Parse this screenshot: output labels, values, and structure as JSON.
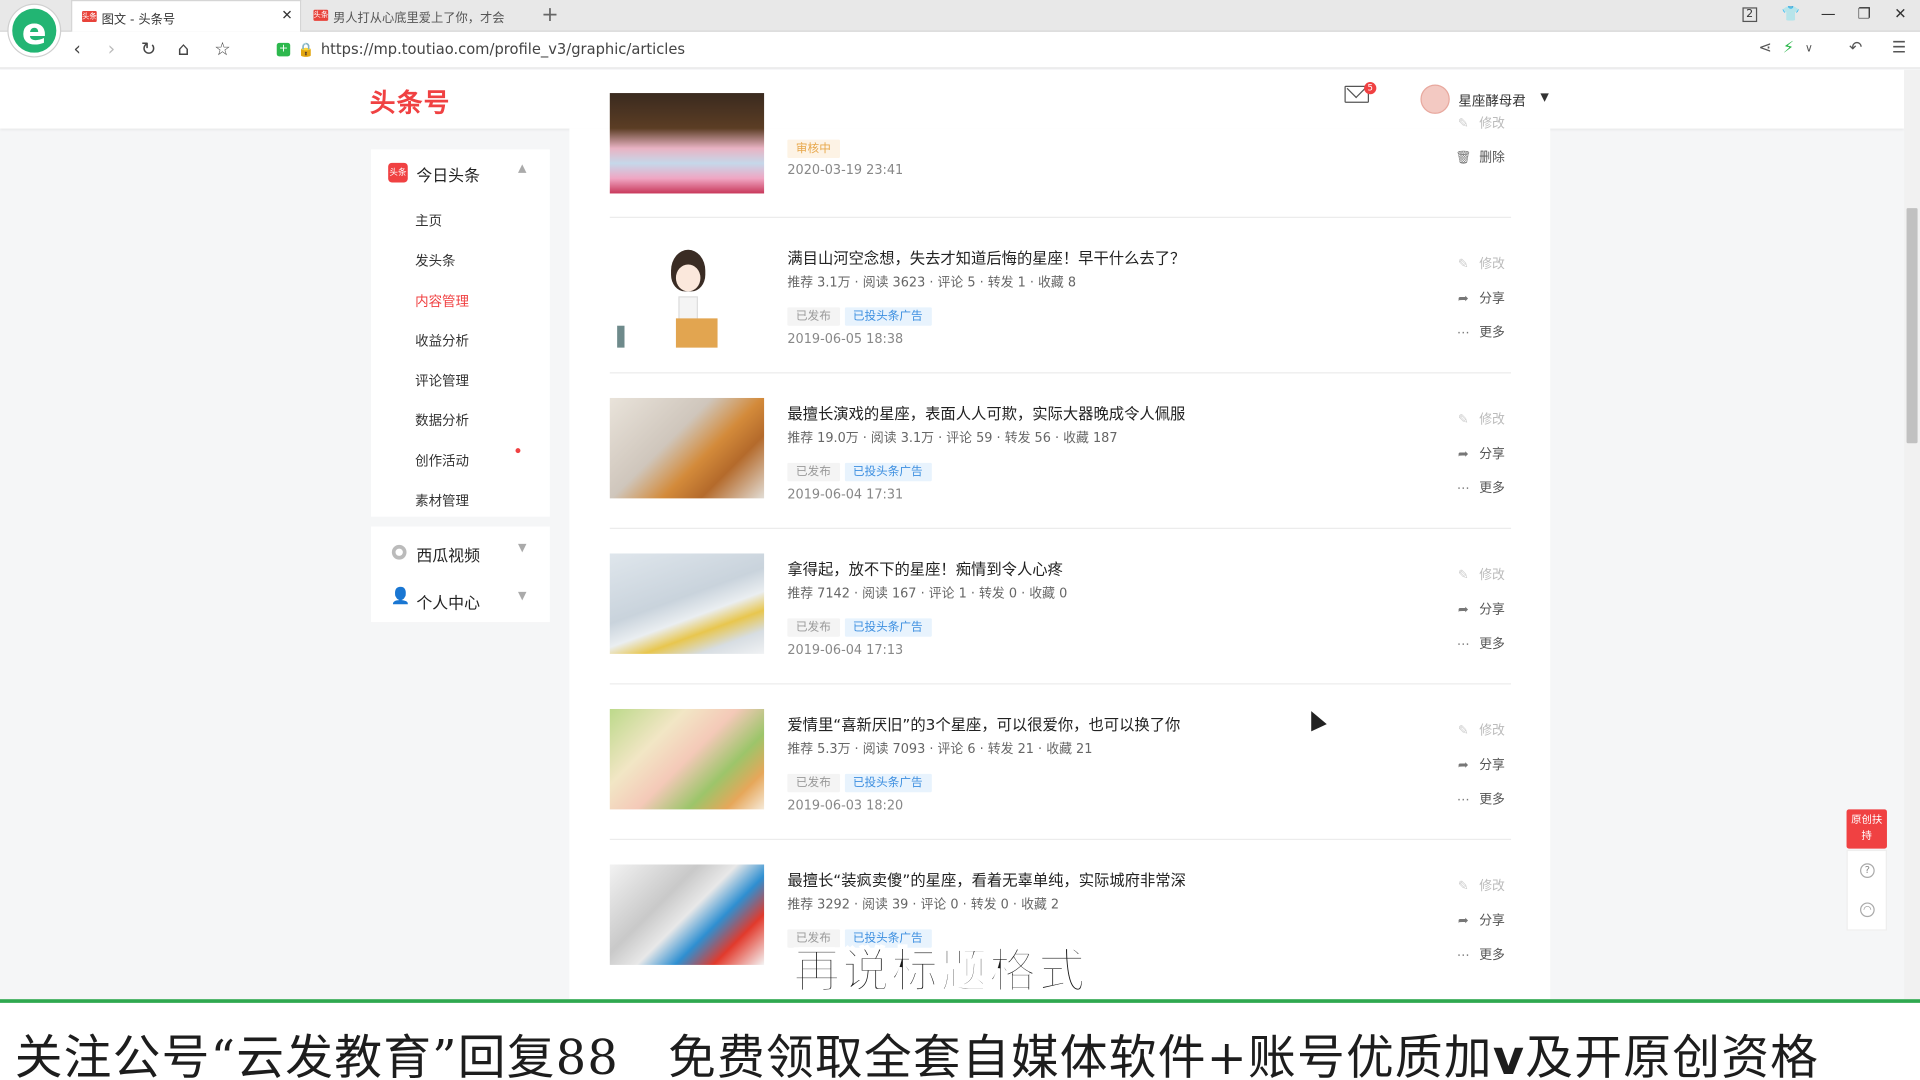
{
  "browser": {
    "tabs": [
      {
        "label": "图文 - 头条号",
        "favicon": "头条"
      },
      {
        "label": "男人打从心底里爱上了你，才会",
        "favicon": "头条"
      }
    ],
    "new_tab": "+",
    "url": "https://mp.toutiao.com/profile_v3/graphic/articles",
    "tab_counter": "2"
  },
  "header": {
    "brand": "头条号",
    "mail_badge": "5",
    "username": "星座酵母君"
  },
  "sidebar": {
    "section1": {
      "label": "今日头条",
      "icon_text": "头条"
    },
    "items": [
      "主页",
      "发头条",
      "内容管理",
      "收益分析",
      "评论管理",
      "数据分析",
      "创作活动",
      "素材管理"
    ],
    "active_index": 2,
    "section2": {
      "label": "西瓜视频"
    },
    "section3": {
      "label": "个人中心"
    }
  },
  "articles": [
    {
      "title": "",
      "stats": "",
      "tags": [
        "审核中"
      ],
      "date": "2020-03-19 23:41",
      "actions": {
        "edit": "修改",
        "delete": "删除"
      }
    },
    {
      "title": "满目山河空念想，失去才知道后悔的星座！早干什么去了？",
      "stats": [
        "推荐 3.1万",
        "阅读 3623",
        "评论 5",
        "转发 1",
        "收藏 8"
      ],
      "tags": [
        "已发布",
        "已投头条广告"
      ],
      "date": "2019-06-05 18:38"
    },
    {
      "title": "最擅长演戏的星座，表面人人可欺，实际大器晚成令人佩服",
      "stats": [
        "推荐 19.0万",
        "阅读 3.1万",
        "评论 59",
        "转发 56",
        "收藏 187"
      ],
      "tags": [
        "已发布",
        "已投头条广告"
      ],
      "date": "2019-06-04 17:31"
    },
    {
      "title": "拿得起，放不下的星座！痴情到令人心疼",
      "stats": [
        "推荐 7142",
        "阅读 167",
        "评论 1",
        "转发 0",
        "收藏 0"
      ],
      "tags": [
        "已发布",
        "已投头条广告"
      ],
      "date": "2019-06-04 17:13"
    },
    {
      "title": "爱情里“喜新厌旧”的3个星座，可以很爱你，也可以换了你",
      "stats": [
        "推荐 5.3万",
        "阅读 7093",
        "评论 6",
        "转发 21",
        "收藏 21"
      ],
      "tags": [
        "已发布",
        "已投头条广告"
      ],
      "date": "2019-06-03 18:20"
    },
    {
      "title": "最擅长“装疯卖傻”的星座，看着无辜单纯，实际城府非常深",
      "stats": [
        "推荐 3292",
        "阅读 39",
        "评论 0",
        "转发 0",
        "收藏 2"
      ],
      "tags": [
        "已发布",
        "已投头条广告"
      ],
      "date": ""
    }
  ],
  "actions": {
    "edit": "修改",
    "share": "分享",
    "more": "更多"
  },
  "float_panel": {
    "label": "原创扶持"
  },
  "overlay": {
    "subtitle": "再说标题格式",
    "banner_pre": "关注公号“云发教育”回复88　免费领取全套自媒体软件+账号优质加",
    "banner_v": "v",
    "banner_post": "及开原创资格"
  }
}
